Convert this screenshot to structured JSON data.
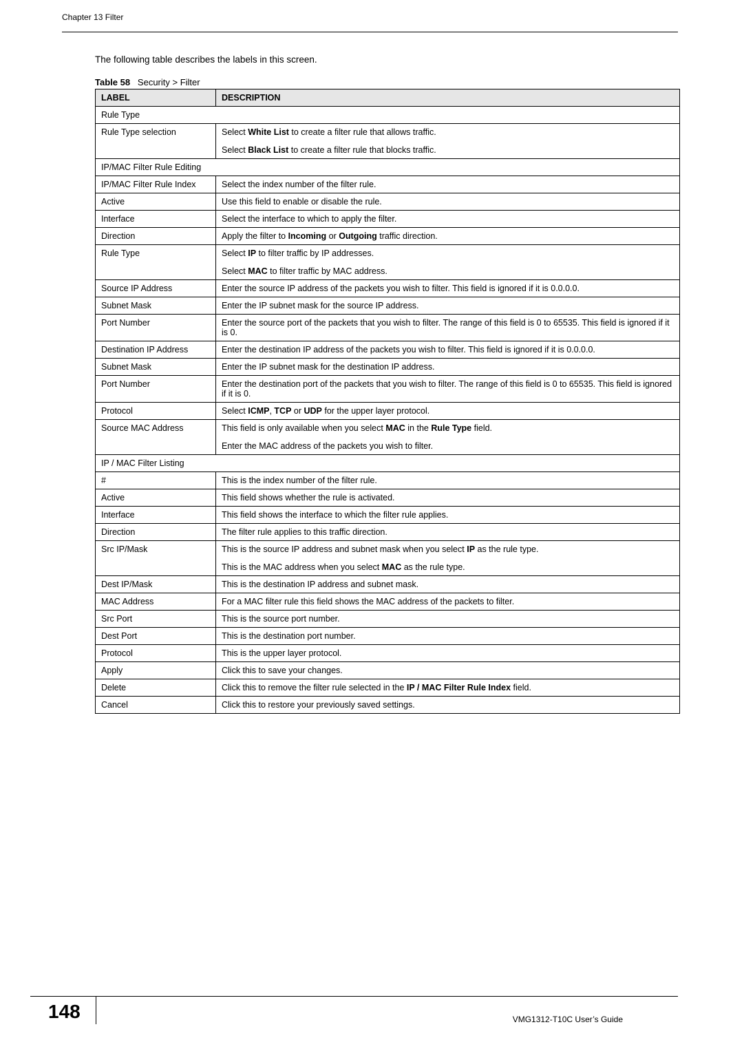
{
  "header": {
    "chapter": "Chapter 13 Filter"
  },
  "intro": "The following table describes the labels in this screen.",
  "table_caption": {
    "prefix": "Table 58",
    "title": "Security > Filter"
  },
  "columns": {
    "label": "LABEL",
    "description": "DESCRIPTION"
  },
  "sections": {
    "rule_type": "Rule Type",
    "ipmac_editing": "IP/MAC Filter Rule Editing",
    "ipmac_listing": "IP / MAC Filter Listing"
  },
  "rows": {
    "rule_type_selection": {
      "label": "Rule Type selection",
      "p1a": "Select ",
      "p1b": "White List",
      "p1c": " to create a filter rule that allows traffic.",
      "p2a": "Select ",
      "p2b": "Black List",
      "p2c": " to create a filter rule that blocks traffic."
    },
    "ipmac_index": {
      "label": "IP/MAC Filter Rule Index",
      "desc": "Select the index number of the filter rule."
    },
    "active": {
      "label": "Active",
      "desc": "Use this field to enable or disable the rule."
    },
    "interface": {
      "label": "Interface",
      "desc": "Select the interface to which to apply the filter."
    },
    "direction": {
      "label": "Direction",
      "p1a": "Apply the filter to ",
      "p1b": "Incoming",
      "p1c": " or ",
      "p1d": "Outgoing",
      "p1e": " traffic direction."
    },
    "rule_type_row": {
      "label": "Rule Type",
      "p1a": "Select ",
      "p1b": "IP",
      "p1c": " to filter traffic by IP addresses.",
      "p2a": "Select ",
      "p2b": "MAC",
      "p2c": " to filter traffic by MAC address."
    },
    "src_ip": {
      "label": "Source IP Address",
      "desc": "Enter the source IP address of the packets you wish to filter. This field is ignored if it is 0.0.0.0."
    },
    "subnet_src": {
      "label": "Subnet Mask",
      "desc": "Enter the IP subnet mask for the source IP address."
    },
    "port_src": {
      "label": "Port Number",
      "desc": "Enter the source port of the packets that you wish to filter. The range of this field is 0 to 65535. This field is ignored if it is 0."
    },
    "dst_ip": {
      "label": "Destination IP Address",
      "desc": "Enter the destination IP address of the packets you wish to filter. This field is ignored if it is 0.0.0.0."
    },
    "subnet_dst": {
      "label": "Subnet Mask",
      "desc": "Enter the IP subnet mask for the destination IP address."
    },
    "port_dst": {
      "label": "Port Number",
      "desc": "Enter the destination port of the packets that you wish to filter. The range of this field is 0 to 65535. This field is ignored if it is 0."
    },
    "protocol": {
      "label": "Protocol",
      "p1a": "Select ",
      "p1b": "ICMP",
      "p1c": ", ",
      "p1d": "TCP",
      "p1e": " or ",
      "p1f": "UDP",
      "p1g": " for the upper layer protocol."
    },
    "src_mac": {
      "label": "Source MAC Address",
      "p1a": "This field is only available when you select ",
      "p1b": "MAC",
      "p1c": " in the ",
      "p1d": "Rule Type",
      "p1e": " field.",
      "p2": "Enter the MAC address of the packets you wish to filter."
    },
    "hash": {
      "label": "#",
      "desc": "This is the index number of the filter rule."
    },
    "active2": {
      "label": "Active",
      "desc": "This field shows whether the rule is activated."
    },
    "interface2": {
      "label": "Interface",
      "desc": "This field shows the interface to which the filter rule applies."
    },
    "direction2": {
      "label": "Direction",
      "desc": "The filter rule applies to this traffic direction."
    },
    "srcipmask": {
      "label": "Src IP/Mask",
      "p1a": "This is the source IP address and subnet mask when you select ",
      "p1b": "IP",
      "p1c": " as the rule type.",
      "p2a": "This is the MAC address when you select ",
      "p2b": "MAC",
      "p2c": " as the rule type."
    },
    "destipmask": {
      "label": "Dest IP/Mask",
      "desc": "This is the destination IP address and subnet mask."
    },
    "macaddr": {
      "label": "MAC Address",
      "desc": "For a MAC filter rule this field shows the MAC address of the packets to filter."
    },
    "srcport": {
      "label": "Src Port",
      "desc": "This is the source port number."
    },
    "destport": {
      "label": "Dest Port",
      "desc": "This is the destination port number."
    },
    "protocol2": {
      "label": "Protocol",
      "desc": "This is the upper layer protocol."
    },
    "apply": {
      "label": "Apply",
      "desc": "Click this to save your changes."
    },
    "delete": {
      "label": "Delete",
      "p1a": "Click this to remove the filter rule selected in the ",
      "p1b": "IP / MAC Filter Rule Index",
      "p1c": " field."
    },
    "cancel": {
      "label": "Cancel",
      "desc": "Click this to restore your previously saved settings."
    }
  },
  "footer": {
    "page": "148",
    "guide": "VMG1312-T10C User’s Guide"
  }
}
